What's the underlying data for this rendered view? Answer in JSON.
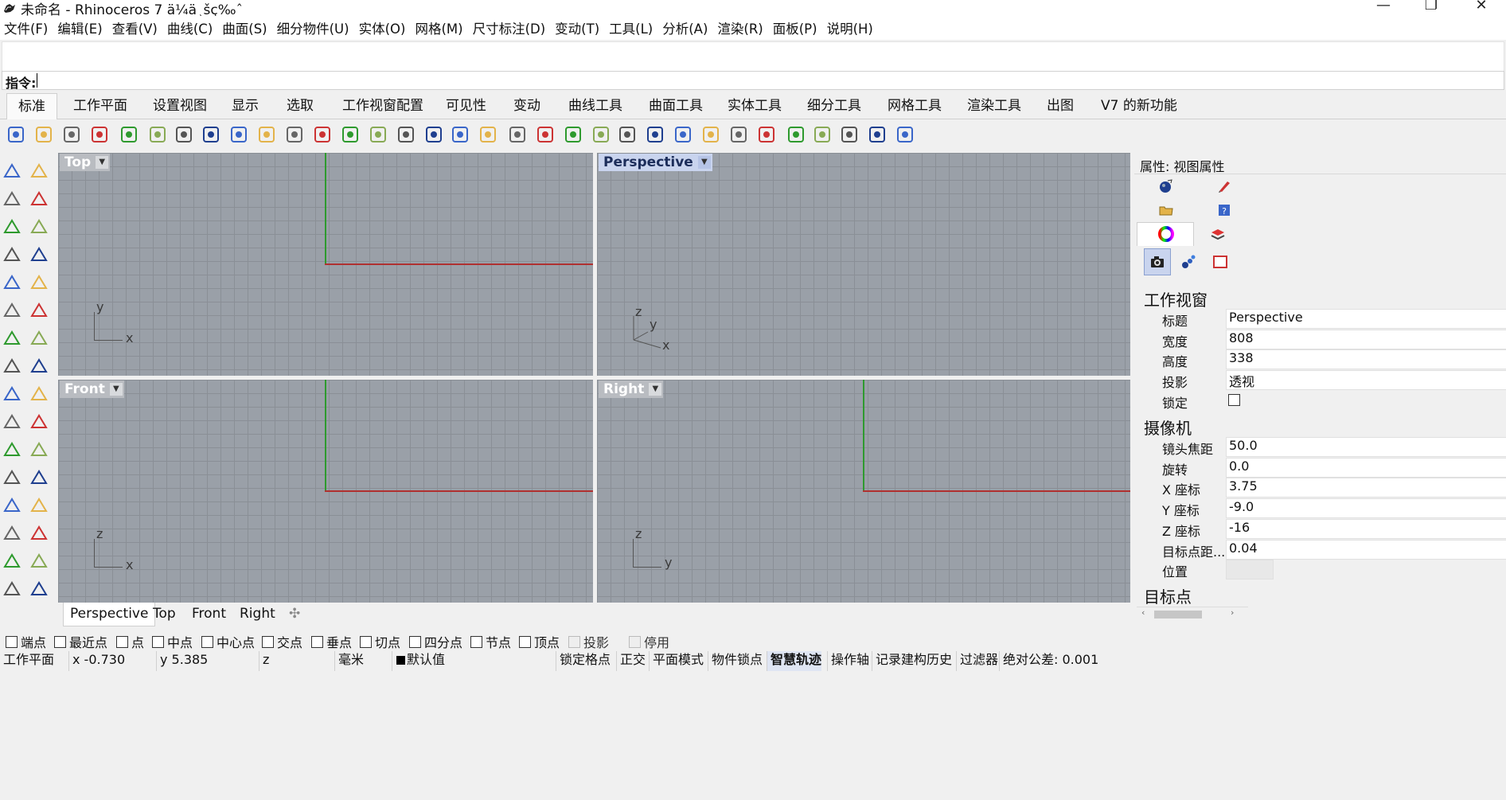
{
  "window": {
    "title": "未命名 - Rhinoceros 7 ä¼ä¸šç‰ˆ",
    "minimize_glyph": "—",
    "maximize_glyph": "❐",
    "close_glyph": "✕"
  },
  "menubar": [
    "文件(F)",
    "编辑(E)",
    "查看(V)",
    "曲线(C)",
    "曲面(S)",
    "细分物件(U)",
    "实体(O)",
    "网格(M)",
    "尺寸标注(D)",
    "变动(T)",
    "工具(L)",
    "分析(A)",
    "渲染(R)",
    "面板(P)",
    "说明(H)"
  ],
  "command": {
    "label": "指令:",
    "value": ""
  },
  "tabs": [
    "标准",
    "工作平面",
    "设置视图",
    "显示",
    "选取",
    "工作视窗配置",
    "可见性",
    "变动",
    "曲线工具",
    "曲面工具",
    "实体工具",
    "细分工具",
    "网格工具",
    "渲染工具",
    "出图",
    "V7 的新功能"
  ],
  "toolbar_icons": [
    "new-icon",
    "open-icon",
    "save-icon",
    "print-icon",
    "import-icon",
    "cut-icon",
    "copy-icon",
    "paste-icon",
    "undo-icon",
    "pan-icon",
    "rotate-view-icon",
    "zoom-dynamic-icon",
    "zoom-window-icon",
    "zoom-extents-icon",
    "zoom-selected-icon",
    "undo-view-icon",
    "four-viewports-icon",
    "car-icon",
    "grid-icon",
    "plane-icon",
    "gumball-icon",
    "light-icon",
    "lock-icon",
    "layer-icon",
    "color-wheel-icon",
    "shade-icon",
    "render-preview-icon",
    "sphere-icon",
    "cursor-filter-icon",
    "gear-icon",
    "select-points-icon",
    "analyze-icon",
    "help-icon"
  ],
  "viewports": {
    "top": {
      "label": "Top",
      "axis1": "y",
      "axis2": "x"
    },
    "perspective": {
      "label": "Perspective",
      "axis_z": "z",
      "axis_y": "y",
      "axis_x": "x"
    },
    "front": {
      "label": "Front",
      "axis1": "z",
      "axis2": "x"
    },
    "right": {
      "label": "Right",
      "axis1": "z",
      "axis2": "y"
    }
  },
  "viewport_tabs": [
    "Perspective",
    "Top",
    "Front",
    "Right"
  ],
  "viewport_tab_add_glyph": "✣",
  "right_panel": {
    "title": "属性: 视图属性",
    "section_viewport": "工作视窗",
    "viewport_props": [
      {
        "key": "标题",
        "value": "Perspective"
      },
      {
        "key": "宽度",
        "value": "808"
      },
      {
        "key": "高度",
        "value": "338"
      },
      {
        "key": "投影",
        "value": "透视"
      },
      {
        "key": "锁定",
        "value": ""
      }
    ],
    "section_camera": "摄像机",
    "camera_props": [
      {
        "key": "镜头焦距",
        "value": "50.0"
      },
      {
        "key": "旋转",
        "value": "0.0"
      },
      {
        "key": "X 座标",
        "value": "3.75"
      },
      {
        "key": "Y 座标",
        "value": "-9.0"
      },
      {
        "key": "Z 座标",
        "value": "-16"
      },
      {
        "key": "目标点距...",
        "value": "0.04"
      },
      {
        "key": "位置",
        "value": ""
      }
    ],
    "section_target": "目标点"
  },
  "osnaps": [
    {
      "label": "端点",
      "checked": false
    },
    {
      "label": "最近点",
      "checked": false
    },
    {
      "label": "点",
      "checked": false
    },
    {
      "label": "中点",
      "checked": false
    },
    {
      "label": "中心点",
      "checked": false
    },
    {
      "label": "交点",
      "checked": false
    },
    {
      "label": "垂点",
      "checked": false
    },
    {
      "label": "切点",
      "checked": false
    },
    {
      "label": "四分点",
      "checked": false
    },
    {
      "label": "节点",
      "checked": false
    },
    {
      "label": "顶点",
      "checked": false
    },
    {
      "label": "投影",
      "checked": false,
      "disabled": true
    },
    {
      "label": "停用",
      "checked": false,
      "disabled": true
    }
  ],
  "statusbar": {
    "cplane": "工作平面",
    "x": "x -0.730",
    "y": "y 5.385",
    "z": "z",
    "units": "毫米",
    "layer": "默认值",
    "items": [
      "锁定格点",
      "正交",
      "平面模式",
      "物件锁点",
      "智慧轨迹",
      "操作轴",
      "记录建构历史",
      "过滤器",
      "绝对公差: 0.001"
    ],
    "bold_item": "智慧轨迹"
  },
  "colors": {
    "viewport_bg": "#9aa0a8",
    "grid_line": "#8a8f96",
    "x_axis": "#b03030",
    "y_axis": "#2e9a2e",
    "active_label_bg": "#c9d4ee"
  }
}
